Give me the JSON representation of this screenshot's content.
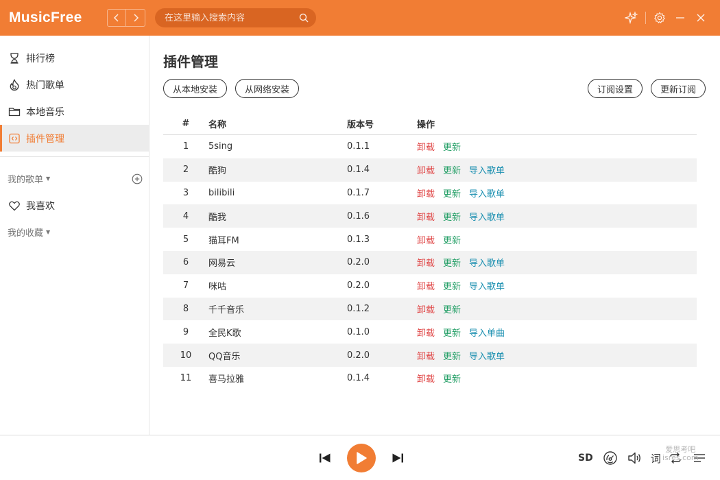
{
  "app": {
    "logo": "MusicFree",
    "accent": "#f17d34"
  },
  "header": {
    "search_placeholder": "在这里输入搜索内容",
    "icons": [
      "chevron-left-icon",
      "chevron-right-icon",
      "search-icon",
      "sparkle-icon",
      "gear-icon",
      "minimize-icon",
      "close-icon"
    ]
  },
  "sidebar": {
    "items": [
      {
        "label": "排行榜",
        "icon": "trophy-icon"
      },
      {
        "label": "热门歌单",
        "icon": "fire-icon"
      },
      {
        "label": "本地音乐",
        "icon": "folder-icon"
      },
      {
        "label": "插件管理",
        "icon": "plugin-icon",
        "active": true
      }
    ],
    "my_playlists": "我的歌单",
    "favorite": "我喜欢",
    "my_collections": "我的收藏"
  },
  "main": {
    "title": "插件管理",
    "buttons": {
      "install_local": "从本地安装",
      "install_network": "从网络安装",
      "subscription_settings": "订阅设置",
      "update_subscription": "更新订阅"
    },
    "columns": {
      "index": "#",
      "name": "名称",
      "version": "版本号",
      "actions": "操作"
    },
    "rows": [
      {
        "index": "1",
        "name": "5sing",
        "version": "0.1.1",
        "actions": [
          "卸载",
          "更新"
        ]
      },
      {
        "index": "2",
        "name": "酷狗",
        "version": "0.1.4",
        "actions": [
          "卸载",
          "更新",
          "导入歌单"
        ]
      },
      {
        "index": "3",
        "name": "bilibili",
        "version": "0.1.7",
        "actions": [
          "卸载",
          "更新",
          "导入歌单"
        ]
      },
      {
        "index": "4",
        "name": "酷我",
        "version": "0.1.6",
        "actions": [
          "卸载",
          "更新",
          "导入歌单"
        ]
      },
      {
        "index": "5",
        "name": "猫耳FM",
        "version": "0.1.3",
        "actions": [
          "卸载",
          "更新"
        ]
      },
      {
        "index": "6",
        "name": "网易云",
        "version": "0.2.0",
        "actions": [
          "卸载",
          "更新",
          "导入歌单"
        ]
      },
      {
        "index": "7",
        "name": "咪咕",
        "version": "0.2.0",
        "actions": [
          "卸载",
          "更新",
          "导入歌单"
        ]
      },
      {
        "index": "8",
        "name": "千千音乐",
        "version": "0.1.2",
        "actions": [
          "卸载",
          "更新"
        ]
      },
      {
        "index": "9",
        "name": "全民K歌",
        "version": "0.1.0",
        "actions": [
          "卸载",
          "更新",
          "导入单曲"
        ]
      },
      {
        "index": "10",
        "name": "QQ音乐",
        "version": "0.2.0",
        "actions": [
          "卸载",
          "更新",
          "导入歌单"
        ]
      },
      {
        "index": "11",
        "name": "喜马拉雅",
        "version": "0.1.4",
        "actions": [
          "卸载",
          "更新"
        ]
      }
    ]
  },
  "player": {
    "quality": "SD",
    "lyric": "词"
  },
  "watermark": {
    "line1": "爱思考吧",
    "line2": "isres.com"
  }
}
